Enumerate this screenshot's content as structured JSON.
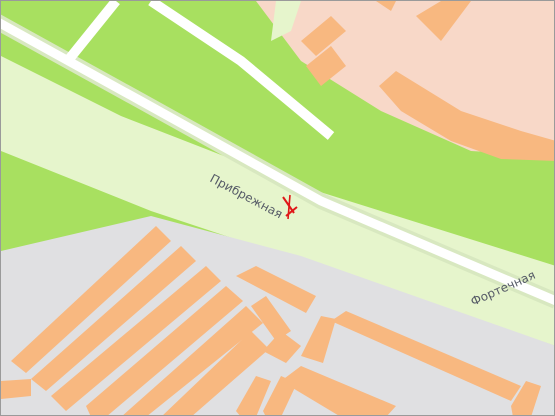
{
  "map": {
    "colors": {
      "park": "#a8e060",
      "park_light": "#e6f5cc",
      "residential": "#f8d8c8",
      "industrial": "#e0e0e2",
      "building": "#f8b880",
      "road": "#ffffff",
      "road_casing": "#d8e8c0",
      "marker": "#e01818"
    },
    "streets": [
      {
        "name": "Прибрежная"
      },
      {
        "name": "Фортечная"
      }
    ],
    "marker": {
      "icon": "location-cross-icon"
    }
  }
}
